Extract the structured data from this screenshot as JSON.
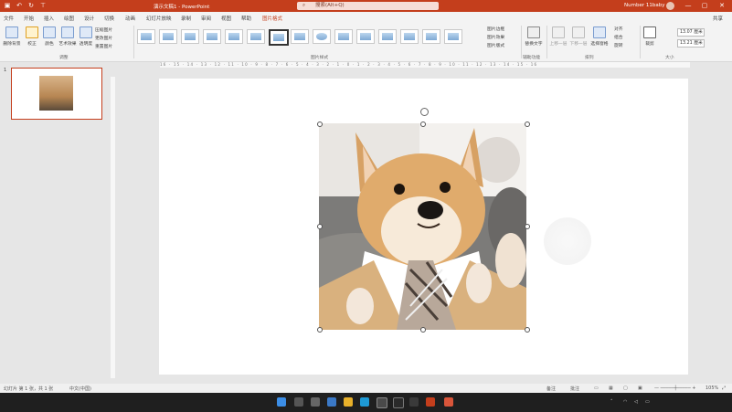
{
  "titlebar": {
    "doc_title": "演示文稿1  -  PowerPoint",
    "search_placeholder": "搜索(Alt+Q)",
    "user_name": "Number 11baby",
    "qa_icons": [
      "save-icon",
      "undo-icon",
      "redo-icon",
      "present-icon"
    ],
    "window_buttons": [
      "—",
      "▢",
      "✕"
    ]
  },
  "tabs": [
    "文件",
    "开始",
    "插入",
    "绘图",
    "设计",
    "切换",
    "动画",
    "幻灯片放映",
    "录制",
    "审阅",
    "视图",
    "帮助",
    "图片格式"
  ],
  "active_tab": "图片格式",
  "share_label": "共享",
  "ribbon": {
    "adjust": {
      "remove_bg": "删除背景",
      "corrections": "校正",
      "color": "颜色",
      "artistic": "艺术效果",
      "transparency": "透明度",
      "compress": "压缩图片",
      "change": "更改图片",
      "reset": "重置图片",
      "group_label": "调整"
    },
    "styles": {
      "group_label": "图片样式",
      "border": "图片边框",
      "effects": "图片效果",
      "layout": "图片版式"
    },
    "accessibility": {
      "alt_text": "替换文字",
      "group_label": "辅助功能"
    },
    "arrange": {
      "forward": "上移一层",
      "backward": "下移一层",
      "selection_pane": "选择窗格",
      "align": "对齐",
      "group": "组合",
      "rotate": "旋转",
      "group_label": "排列"
    },
    "size": {
      "crop": "裁剪",
      "height": "13.07 厘米",
      "width": "13.21 厘米",
      "group_label": "大小"
    }
  },
  "thumbnails": [
    {
      "number": "1"
    }
  ],
  "ruler_text": "16 · 15 · 14 · 13 · 12 · 11 · 10 · 9 · 8 · 7 · 6 · 5 · 4 · 3 · 2 · 1 · 0 · 1 · 2 · 3 · 4 · 5 · 6 · 7 · 8 · 9 · 10 · 11 · 12 · 13 · 14 · 15 · 16",
  "status": {
    "slide_info": "幻灯片 第 1 张，共 1 张",
    "language": "中文(中国)",
    "notes": "备注",
    "comments": "批注",
    "zoom": "105%"
  },
  "taskbar_icons": [
    "windows-start-icon",
    "search-icon",
    "task-view-icon",
    "widgets-icon",
    "chat-icon",
    "file-explorer-icon",
    "edge-icon",
    "store-icon",
    "app-icon",
    "powerpoint-icon",
    "app2-icon"
  ],
  "colors": {
    "accent": "#c43e1c",
    "taskbar": "#1f1f1f"
  }
}
